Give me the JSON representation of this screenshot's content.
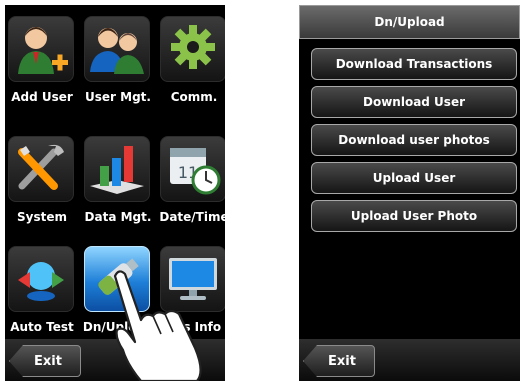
{
  "left_screen": {
    "tiles": [
      {
        "label": "Add User",
        "icon": "add-user-icon"
      },
      {
        "label": "User Mgt.",
        "icon": "users-icon"
      },
      {
        "label": "Comm.",
        "icon": "gear-icon"
      },
      {
        "label": "System",
        "icon": "tools-icon"
      },
      {
        "label": "Data Mgt.",
        "icon": "bar-chart-icon"
      },
      {
        "label": "Date/Time",
        "icon": "calendar-clock-icon"
      },
      {
        "label": "Auto Test",
        "icon": "auto-test-icon"
      },
      {
        "label": "Dn/Upload",
        "icon": "usb-drive-icon"
      },
      {
        "label": "Sys Info",
        "icon": "monitor-icon"
      }
    ],
    "selected_tile": "Dn/Upload",
    "exit_label": "Exit"
  },
  "right_screen": {
    "title": "Dn/Upload",
    "menu_items": [
      {
        "label": "Download Transactions"
      },
      {
        "label": "Download User"
      },
      {
        "label": "Download user photos"
      },
      {
        "label": "Upload User"
      },
      {
        "label": "Upload User Photo"
      }
    ],
    "exit_label": "Exit"
  },
  "colors": {
    "screen_bg": "#000000",
    "selected_tile": "#1e7fd8",
    "text": "#ffffff"
  }
}
